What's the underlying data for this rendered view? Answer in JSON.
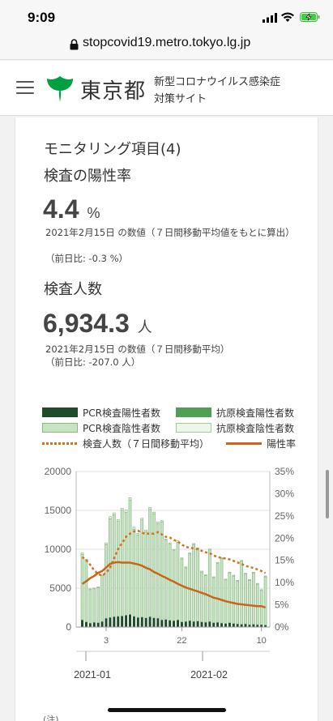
{
  "status_bar": {
    "time": "9:09"
  },
  "browser": {
    "url": "stopcovid19.metro.tokyo.lg.jp"
  },
  "header": {
    "logo_text": "東京都",
    "site_title_line1": "新型コロナウイルス感染症",
    "site_title_line2": "対策サイト"
  },
  "card": {
    "heading": "モニタリング項目(4)",
    "positivity": {
      "title": "検査の陽性率",
      "value": "4.4",
      "unit": "%",
      "note": "2021年2月15日 の数値（７日間移動平均値をもとに算出）",
      "diff": "（前日比: -0.3 %）"
    },
    "tests": {
      "title": "検査人数",
      "value": "6,934.3",
      "unit": "人",
      "note": "2021年2月15日 の数値（７日間移動平均）",
      "diff": "（前日比: -207.0 人）"
    },
    "legend": {
      "pcr_positive": "PCR検査陽性者数",
      "antigen_positive": "抗原検査陽性者数",
      "pcr_negative": "PCR検査陰性者数",
      "antigen_negative": "抗原検査陰性者数",
      "tests_avg": "検査人数（７日間移動平均）",
      "positivity_rate": "陽性率"
    },
    "bottom_note": "(注)"
  },
  "colors": {
    "pcr_positive": "#1f4d2b",
    "antigen_positive": "#4fa052",
    "pcr_negative": "#c7e3c3",
    "antigen_negative": "#eef5ec",
    "tests_avg": "#d3721a",
    "positivity_rate": "#c7661b"
  },
  "chart_data": {
    "type": "bar",
    "left_axis": {
      "ylim": [
        0,
        20000
      ],
      "ticks": [
        "0",
        "5000",
        "10000",
        "15000",
        "20000"
      ]
    },
    "right_axis": {
      "ylim": [
        0,
        35
      ],
      "ticks": [
        "0%",
        "5%",
        "10%",
        "15%",
        "20%",
        "25%",
        "30%",
        "35%"
      ]
    },
    "x_day_ticks": [
      "3",
      "22",
      "10"
    ],
    "x_month_labels": [
      "2021-01",
      "2021-02"
    ],
    "series": [
      {
        "name": "PCR検査陽性者数",
        "values": [
          900,
          650,
          500,
          600,
          550,
          700,
          1100,
          1200,
          1300,
          1350,
          1400,
          1500,
          1600,
          1350,
          1200,
          1250,
          1150,
          1300,
          1150,
          1100,
          900,
          950,
          850,
          800,
          900,
          650,
          700,
          800,
          700,
          750,
          650,
          600,
          700,
          550,
          600,
          500,
          450,
          550,
          450,
          400,
          350,
          400,
          300,
          350,
          300,
          300,
          250
        ]
      },
      {
        "name": "PCR検査陰性者数",
        "values": [
          8400,
          7900,
          4300,
          4300,
          4500,
          5900,
          9500,
          12700,
          13100,
          12200,
          13600,
          13200,
          14700,
          11200,
          10600,
          12500,
          11100,
          13800,
          13400,
          12200,
          12600,
          10200,
          9800,
          9000,
          10000,
          8100,
          6900,
          8600,
          9900,
          9300,
          6400,
          6000,
          9200,
          5800,
          7600,
          8300,
          5600,
          6400,
          6100,
          5500,
          8100,
          6400,
          5700,
          6600,
          5200,
          4400,
          6200
        ]
      },
      {
        "name": "抗原検査陽性者数",
        "values": [
          20,
          15,
          10,
          10,
          10,
          15,
          25,
          30,
          30,
          30,
          30,
          35,
          35,
          30,
          25,
          25,
          25,
          30,
          25,
          25,
          20,
          20,
          20,
          20,
          20,
          15,
          15,
          15,
          15,
          15,
          15,
          15,
          15,
          10,
          10,
          10,
          10,
          10,
          10,
          10,
          10,
          10,
          10,
          10,
          10,
          10,
          10
        ]
      },
      {
        "name": "抗原検査陰性者数",
        "values": [
          200,
          150,
          100,
          100,
          100,
          150,
          200,
          250,
          250,
          250,
          250,
          300,
          300,
          250,
          200,
          200,
          200,
          250,
          200,
          200,
          150,
          150,
          150,
          150,
          150,
          120,
          120,
          120,
          120,
          120,
          120,
          120,
          120,
          100,
          100,
          100,
          100,
          100,
          100,
          100,
          100,
          100,
          100,
          100,
          100,
          100,
          100
        ]
      },
      {
        "name": "検査人数（７日間移動平均）",
        "type": "line",
        "axis": "left",
        "values": [
          9000,
          8600,
          8000,
          7300,
          6800,
          6600,
          7000,
          7600,
          8800,
          10000,
          10800,
          11600,
          12000,
          12300,
          12400,
          12100,
          12000,
          12000,
          12000,
          12200,
          11900,
          11600,
          11500,
          11200,
          11000,
          10600,
          10300,
          10200,
          10100,
          10000,
          9800,
          9600,
          9500,
          9200,
          9000,
          8900,
          8800,
          8700,
          8500,
          8300,
          8100,
          7900,
          7700,
          7600,
          7400,
          7200,
          6934.3
        ]
      },
      {
        "name": "陽性率",
        "type": "line",
        "axis": "right",
        "values": [
          9.7,
          10.3,
          11.0,
          11.5,
          12.2,
          12.6,
          13.4,
          14.2,
          14.5,
          14.6,
          14.5,
          14.5,
          14.5,
          14.3,
          14.1,
          13.8,
          13.3,
          13.0,
          12.4,
          12.0,
          11.5,
          11.1,
          10.6,
          10.2,
          9.7,
          9.3,
          8.9,
          8.6,
          8.3,
          8.0,
          7.7,
          7.4,
          7.0,
          6.6,
          6.4,
          6.1,
          5.8,
          5.6,
          5.4,
          5.2,
          5.1,
          5.0,
          4.9,
          4.8,
          4.7,
          4.7,
          4.4
        ]
      }
    ]
  }
}
